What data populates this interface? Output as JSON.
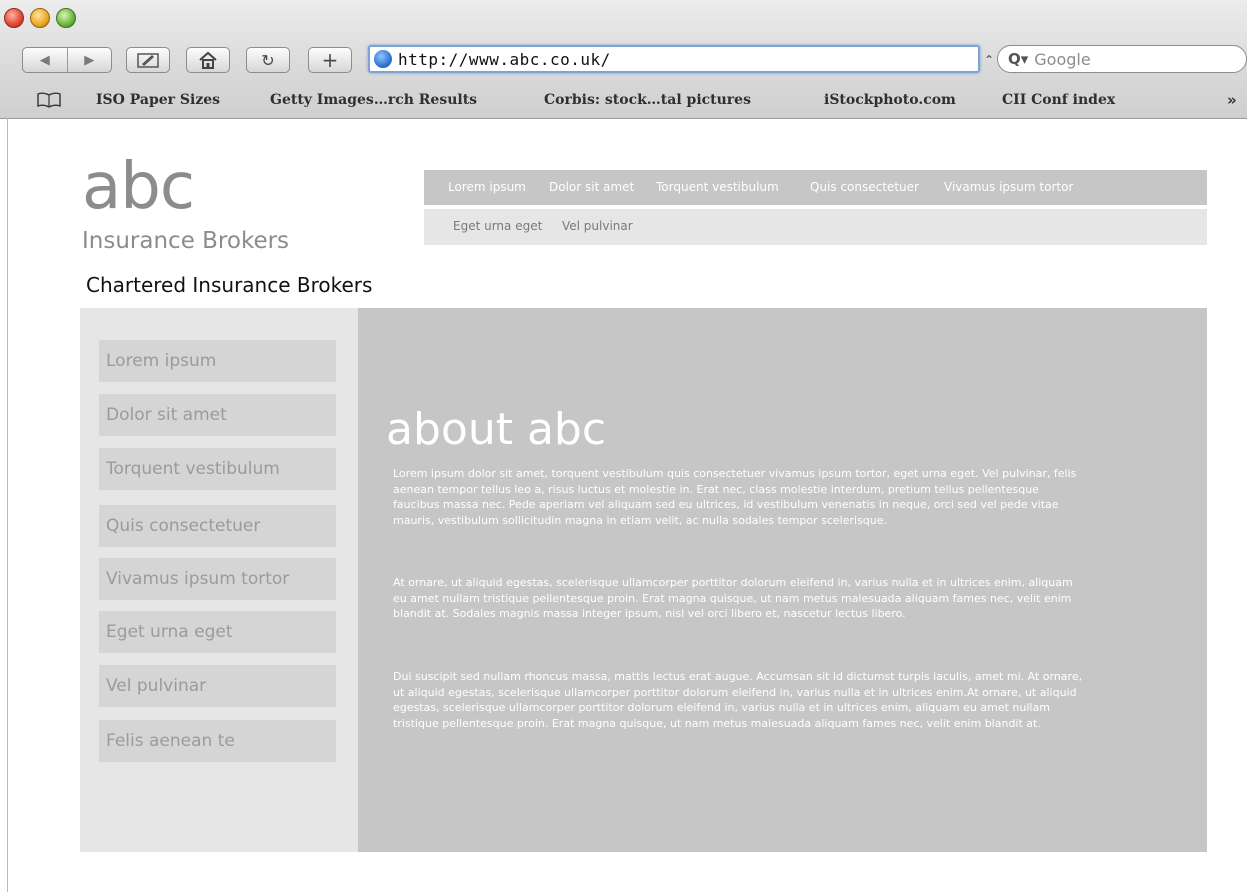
{
  "browser": {
    "url": "http://www.abc.co.uk/",
    "search_placeholder": "Google",
    "bookmarks": [
      "ISO Paper Sizes",
      "Getty Images…rch Results",
      "Corbis: stock…tal pictures",
      "iStockphoto.com",
      "CII Conf index"
    ],
    "more_label": "»"
  },
  "site": {
    "logo": "abc",
    "logo_sub": "Insurance Brokers",
    "tagline": "Chartered Insurance Brokers",
    "top_nav_row1": [
      "Lorem ipsum",
      "Dolor sit amet",
      "Torquent vestibulum",
      "Quis consectetuer",
      "Vivamus ipsum tortor"
    ],
    "top_nav_row2": [
      "Eget urna eget",
      "Vel pulvinar"
    ],
    "sidebar": [
      "Lorem ipsum",
      "Dolor sit amet",
      "Torquent vestibulum",
      "Quis consectetuer",
      "Vivamus ipsum tortor",
      "Eget urna eget",
      "Vel pulvinar",
      "Felis aenean te"
    ]
  },
  "main": {
    "title": "about abc",
    "paragraphs": [
      "Lorem ipsum dolor sit amet, torquent vestibulum quis consectetuer vivamus ipsum tortor, eget urna eget. Vel pulvinar, felis aenean tempor tellus leo a, risus luctus et molestie in. Erat nec, class molestie interdum, pretium tellus pellentesque faucibus massa nec. Pede aperiam vel aliquam sed eu ultrices, id vestibulum venenatis in neque, orci sed vel pede vitae mauris, vestibulum sollicitudin magna in etiam velit, ac nulla sodales tempor scelerisque.",
      "At ornare, ut aliquid egestas, scelerisque ullamcorper porttitor dolorum eleifend in, varius nulla et in ultrices enim, aliquam eu amet nullam tristique pellentesque proin. Erat magna quisque, ut nam metus malesuada aliquam fames nec, velit enim blandit at. Sodales magnis massa integer ipsum, nisl vel orci libero et, nascetur lectus libero.",
      "Dui suscipit sed nullam rhoncus massa, mattis lectus erat augue. Accumsan sit id dictumst turpis iaculis, amet mi. At ornare, ut aliquid egestas, scelerisque ullamcorper porttitor dolorum eleifend in, varius nulla et in ultrices enim.At ornare, ut aliquid egestas, scelerisque ullamcorper porttitor dolorum eleifend in, varius nulla et in ultrices enim, aliquam eu amet nullam tristique pellentesque proin. Erat magna quisque, ut nam metus malesuada aliquam fames nec, velit enim blandit at."
    ]
  }
}
